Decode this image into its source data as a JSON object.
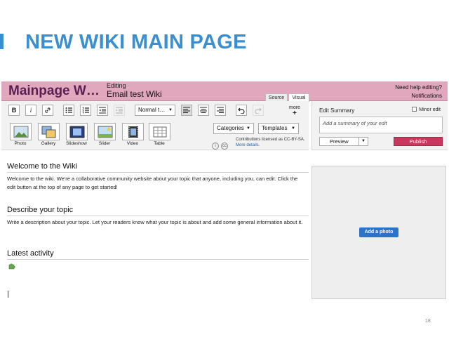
{
  "slide": {
    "title": "NEW WIKI MAIN PAGE",
    "page_number": "18",
    "accent_color": "#3a8fd0"
  },
  "header": {
    "page_name": "Mainpage W…",
    "editing_label": "Editing",
    "editing_title": "Email test Wiki",
    "help_link": "Need help editing?",
    "notifications_link": "Notifications",
    "tabs": [
      "Source",
      "Visual"
    ],
    "bg_color": "#e1a7bd"
  },
  "toolbar": {
    "bold": "B",
    "italic": "i",
    "format_select": "Normal t…",
    "more_label": "more",
    "more_plus": "+",
    "insert_buttons": [
      "Photo",
      "Gallery",
      "Slideshow",
      "Slider",
      "Video",
      "Table"
    ],
    "categories_select": "Categories",
    "templates_select": "Templates",
    "license_line1": "Contributions licensed as CC-BY-SA.",
    "license_line2": "More details."
  },
  "summary": {
    "label": "Edit Summary",
    "minor_edit_label": "Minor edit",
    "placeholder": "Add a summary of your edit",
    "preview_label": "Preview",
    "publish_label": "Publish",
    "publish_color": "#c8375d"
  },
  "content": {
    "sections": [
      {
        "heading": "Welcome to the Wiki",
        "body": "Welcome to the wiki. We're a collaborative community website about your topic that anyone, including you, can edit. Click the edit button at the top of any page to get started!"
      },
      {
        "heading": "Describe your topic",
        "body": "Write a description about your topic. Let your readers know what your topic is about and add some general information about it."
      },
      {
        "heading": "Latest activity",
        "body": ""
      }
    ]
  },
  "photo_panel": {
    "add_photo_label": "Add a photo"
  }
}
